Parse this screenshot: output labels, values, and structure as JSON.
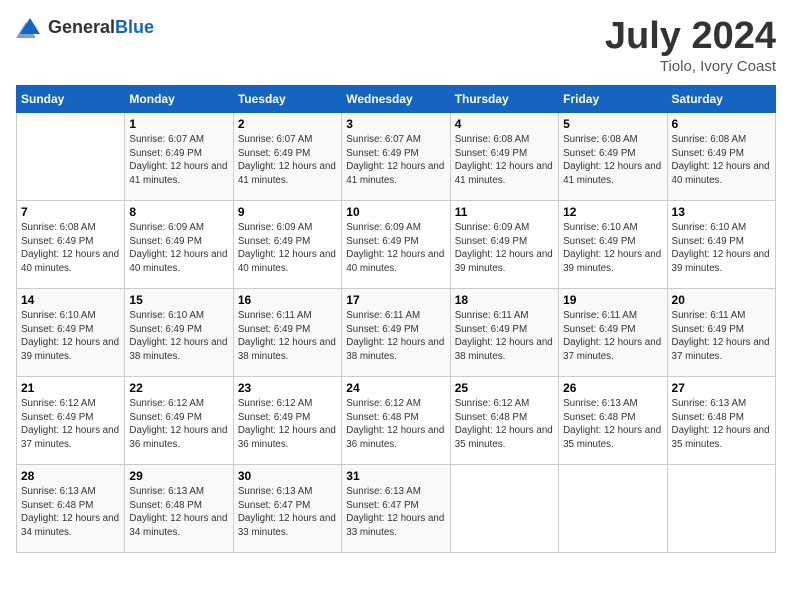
{
  "header": {
    "logo_general": "General",
    "logo_blue": "Blue",
    "month_year": "July 2024",
    "location": "Tiolo, Ivory Coast"
  },
  "days_of_week": [
    "Sunday",
    "Monday",
    "Tuesday",
    "Wednesday",
    "Thursday",
    "Friday",
    "Saturday"
  ],
  "weeks": [
    [
      {
        "day": "",
        "sunrise": "",
        "sunset": "",
        "daylight": ""
      },
      {
        "day": "1",
        "sunrise": "Sunrise: 6:07 AM",
        "sunset": "Sunset: 6:49 PM",
        "daylight": "Daylight: 12 hours and 41 minutes."
      },
      {
        "day": "2",
        "sunrise": "Sunrise: 6:07 AM",
        "sunset": "Sunset: 6:49 PM",
        "daylight": "Daylight: 12 hours and 41 minutes."
      },
      {
        "day": "3",
        "sunrise": "Sunrise: 6:07 AM",
        "sunset": "Sunset: 6:49 PM",
        "daylight": "Daylight: 12 hours and 41 minutes."
      },
      {
        "day": "4",
        "sunrise": "Sunrise: 6:08 AM",
        "sunset": "Sunset: 6:49 PM",
        "daylight": "Daylight: 12 hours and 41 minutes."
      },
      {
        "day": "5",
        "sunrise": "Sunrise: 6:08 AM",
        "sunset": "Sunset: 6:49 PM",
        "daylight": "Daylight: 12 hours and 41 minutes."
      },
      {
        "day": "6",
        "sunrise": "Sunrise: 6:08 AM",
        "sunset": "Sunset: 6:49 PM",
        "daylight": "Daylight: 12 hours and 40 minutes."
      }
    ],
    [
      {
        "day": "7",
        "sunrise": "Sunrise: 6:08 AM",
        "sunset": "Sunset: 6:49 PM",
        "daylight": "Daylight: 12 hours and 40 minutes."
      },
      {
        "day": "8",
        "sunrise": "Sunrise: 6:09 AM",
        "sunset": "Sunset: 6:49 PM",
        "daylight": "Daylight: 12 hours and 40 minutes."
      },
      {
        "day": "9",
        "sunrise": "Sunrise: 6:09 AM",
        "sunset": "Sunset: 6:49 PM",
        "daylight": "Daylight: 12 hours and 40 minutes."
      },
      {
        "day": "10",
        "sunrise": "Sunrise: 6:09 AM",
        "sunset": "Sunset: 6:49 PM",
        "daylight": "Daylight: 12 hours and 40 minutes."
      },
      {
        "day": "11",
        "sunrise": "Sunrise: 6:09 AM",
        "sunset": "Sunset: 6:49 PM",
        "daylight": "Daylight: 12 hours and 39 minutes."
      },
      {
        "day": "12",
        "sunrise": "Sunrise: 6:10 AM",
        "sunset": "Sunset: 6:49 PM",
        "daylight": "Daylight: 12 hours and 39 minutes."
      },
      {
        "day": "13",
        "sunrise": "Sunrise: 6:10 AM",
        "sunset": "Sunset: 6:49 PM",
        "daylight": "Daylight: 12 hours and 39 minutes."
      }
    ],
    [
      {
        "day": "14",
        "sunrise": "Sunrise: 6:10 AM",
        "sunset": "Sunset: 6:49 PM",
        "daylight": "Daylight: 12 hours and 39 minutes."
      },
      {
        "day": "15",
        "sunrise": "Sunrise: 6:10 AM",
        "sunset": "Sunset: 6:49 PM",
        "daylight": "Daylight: 12 hours and 38 minutes."
      },
      {
        "day": "16",
        "sunrise": "Sunrise: 6:11 AM",
        "sunset": "Sunset: 6:49 PM",
        "daylight": "Daylight: 12 hours and 38 minutes."
      },
      {
        "day": "17",
        "sunrise": "Sunrise: 6:11 AM",
        "sunset": "Sunset: 6:49 PM",
        "daylight": "Daylight: 12 hours and 38 minutes."
      },
      {
        "day": "18",
        "sunrise": "Sunrise: 6:11 AM",
        "sunset": "Sunset: 6:49 PM",
        "daylight": "Daylight: 12 hours and 38 minutes."
      },
      {
        "day": "19",
        "sunrise": "Sunrise: 6:11 AM",
        "sunset": "Sunset: 6:49 PM",
        "daylight": "Daylight: 12 hours and 37 minutes."
      },
      {
        "day": "20",
        "sunrise": "Sunrise: 6:11 AM",
        "sunset": "Sunset: 6:49 PM",
        "daylight": "Daylight: 12 hours and 37 minutes."
      }
    ],
    [
      {
        "day": "21",
        "sunrise": "Sunrise: 6:12 AM",
        "sunset": "Sunset: 6:49 PM",
        "daylight": "Daylight: 12 hours and 37 minutes."
      },
      {
        "day": "22",
        "sunrise": "Sunrise: 6:12 AM",
        "sunset": "Sunset: 6:49 PM",
        "daylight": "Daylight: 12 hours and 36 minutes."
      },
      {
        "day": "23",
        "sunrise": "Sunrise: 6:12 AM",
        "sunset": "Sunset: 6:49 PM",
        "daylight": "Daylight: 12 hours and 36 minutes."
      },
      {
        "day": "24",
        "sunrise": "Sunrise: 6:12 AM",
        "sunset": "Sunset: 6:48 PM",
        "daylight": "Daylight: 12 hours and 36 minutes."
      },
      {
        "day": "25",
        "sunrise": "Sunrise: 6:12 AM",
        "sunset": "Sunset: 6:48 PM",
        "daylight": "Daylight: 12 hours and 35 minutes."
      },
      {
        "day": "26",
        "sunrise": "Sunrise: 6:13 AM",
        "sunset": "Sunset: 6:48 PM",
        "daylight": "Daylight: 12 hours and 35 minutes."
      },
      {
        "day": "27",
        "sunrise": "Sunrise: 6:13 AM",
        "sunset": "Sunset: 6:48 PM",
        "daylight": "Daylight: 12 hours and 35 minutes."
      }
    ],
    [
      {
        "day": "28",
        "sunrise": "Sunrise: 6:13 AM",
        "sunset": "Sunset: 6:48 PM",
        "daylight": "Daylight: 12 hours and 34 minutes."
      },
      {
        "day": "29",
        "sunrise": "Sunrise: 6:13 AM",
        "sunset": "Sunset: 6:48 PM",
        "daylight": "Daylight: 12 hours and 34 minutes."
      },
      {
        "day": "30",
        "sunrise": "Sunrise: 6:13 AM",
        "sunset": "Sunset: 6:47 PM",
        "daylight": "Daylight: 12 hours and 33 minutes."
      },
      {
        "day": "31",
        "sunrise": "Sunrise: 6:13 AM",
        "sunset": "Sunset: 6:47 PM",
        "daylight": "Daylight: 12 hours and 33 minutes."
      },
      {
        "day": "",
        "sunrise": "",
        "sunset": "",
        "daylight": ""
      },
      {
        "day": "",
        "sunrise": "",
        "sunset": "",
        "daylight": ""
      },
      {
        "day": "",
        "sunrise": "",
        "sunset": "",
        "daylight": ""
      }
    ]
  ]
}
